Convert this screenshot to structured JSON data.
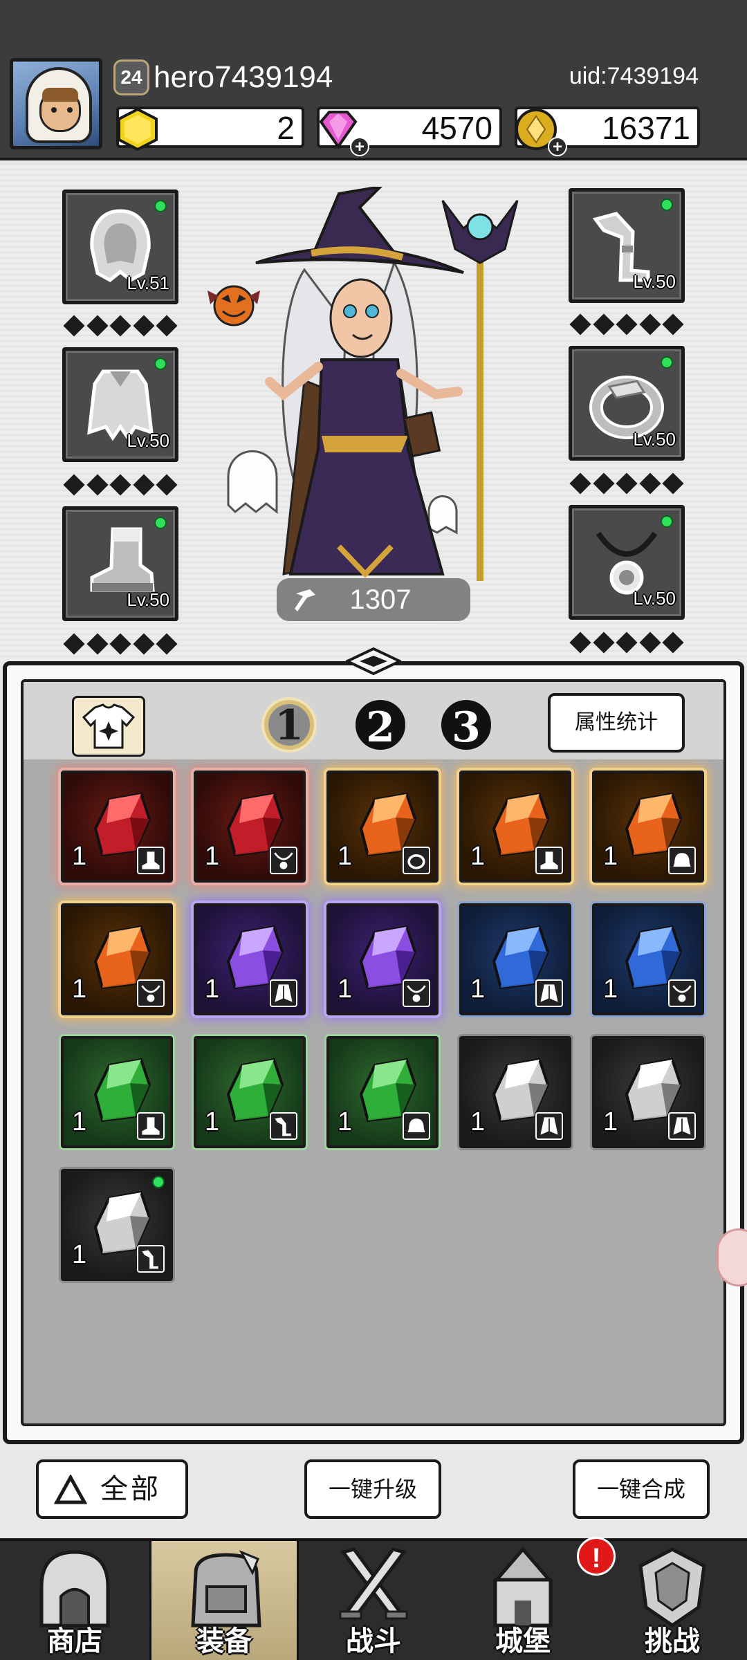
{
  "header": {
    "player_level": "24",
    "username": "hero7439194",
    "uid": "uid:7439194",
    "resources": [
      {
        "name": "gold-hex",
        "value": "2",
        "color": "#f2d21b"
      },
      {
        "name": "gem",
        "value": "4570",
        "color": "#e55ad0"
      },
      {
        "name": "coin",
        "value": "16371",
        "color": "#d9ad1e"
      }
    ]
  },
  "equipment": {
    "left": [
      {
        "slot": "helmet",
        "level": "Lv.51",
        "icon": "hood-icon"
      },
      {
        "slot": "armor",
        "level": "Lv.50",
        "icon": "cape-icon"
      },
      {
        "slot": "boots",
        "level": "Lv.50",
        "icon": "boot-icon"
      }
    ],
    "right": [
      {
        "slot": "weapon",
        "level": "Lv.50",
        "icon": "pipe-icon"
      },
      {
        "slot": "ring",
        "level": "Lv.50",
        "icon": "ring-icon"
      },
      {
        "slot": "necklace",
        "level": "Lv.50",
        "icon": "necklace-icon"
      }
    ],
    "star_rows": 5
  },
  "hero": {
    "power": "1307",
    "name_icon": "witch-hero"
  },
  "inventory": {
    "tabs": [
      "1",
      "2",
      "3"
    ],
    "active_tab": "1",
    "stats_button": "属性统计",
    "items": [
      {
        "rarity": "red",
        "count": "1",
        "slot_icon": "boot-icon"
      },
      {
        "rarity": "red",
        "count": "1",
        "slot_icon": "necklace-icon"
      },
      {
        "rarity": "orange",
        "count": "1",
        "slot_icon": "ring-icon"
      },
      {
        "rarity": "orange",
        "count": "1",
        "slot_icon": "boot-icon"
      },
      {
        "rarity": "orange",
        "count": "1",
        "slot_icon": "helmet-icon"
      },
      {
        "rarity": "orange",
        "count": "1",
        "slot_icon": "necklace-icon"
      },
      {
        "rarity": "purple",
        "count": "1",
        "slot_icon": "cape-icon"
      },
      {
        "rarity": "purple",
        "count": "1",
        "slot_icon": "necklace-icon"
      },
      {
        "rarity": "blue",
        "count": "1",
        "slot_icon": "cape-icon"
      },
      {
        "rarity": "blue",
        "count": "1",
        "slot_icon": "necklace-icon"
      },
      {
        "rarity": "green",
        "count": "1",
        "slot_icon": "boot-icon"
      },
      {
        "rarity": "green",
        "count": "1",
        "slot_icon": "pipe-icon"
      },
      {
        "rarity": "green",
        "count": "1",
        "slot_icon": "helmet-icon"
      },
      {
        "rarity": "grey",
        "count": "1",
        "slot_icon": "cape-icon"
      },
      {
        "rarity": "grey",
        "count": "1",
        "slot_icon": "cape-icon"
      },
      {
        "rarity": "grey",
        "count": "1",
        "slot_icon": "pipe-icon",
        "new": true
      }
    ]
  },
  "actions": {
    "all": "全部",
    "upgrade_all": "一键升级",
    "merge_all": "一键合成"
  },
  "nav": [
    {
      "label": "商店",
      "icon": "shop-icon"
    },
    {
      "label": "装备",
      "icon": "backpack-icon"
    },
    {
      "label": "战斗",
      "icon": "swords-icon"
    },
    {
      "label": "城堡",
      "icon": "castle-icon"
    },
    {
      "label": "挑战",
      "icon": "helmet-emblem-icon"
    }
  ],
  "active_nav": "装备",
  "castle_alert": "!"
}
